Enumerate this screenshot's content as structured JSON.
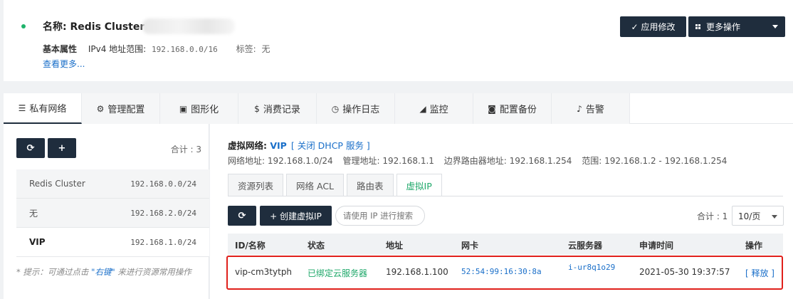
{
  "header": {
    "name_label": "名称: Redis Cluster",
    "attr_title": "基本属性",
    "ipv4_label": "IPv4 地址范围:",
    "ipv4_value": "192.168.0.0/16",
    "tags_label": "标签:",
    "tags_value": "无",
    "more_link": "查看更多...",
    "apply_button": "应用修改",
    "more_actions_button": "更多操作",
    "status_color": "#1fb36b"
  },
  "tabs": [
    {
      "label": "私有网络",
      "icon": "list-icon",
      "glyph": "☰"
    },
    {
      "label": "管理配置",
      "icon": "gears-icon",
      "glyph": "⚙"
    },
    {
      "label": "图形化",
      "icon": "image-icon",
      "glyph": "▣"
    },
    {
      "label": "消费记录",
      "icon": "dollar-icon",
      "glyph": "$"
    },
    {
      "label": "操作日志",
      "icon": "clock-icon",
      "glyph": "◷"
    },
    {
      "label": "监控",
      "icon": "area-chart-icon",
      "glyph": "◢"
    },
    {
      "label": "配置备份",
      "icon": "camera-icon",
      "glyph": "◙"
    },
    {
      "label": "告警",
      "icon": "bell-icon",
      "glyph": "♪"
    }
  ],
  "left": {
    "refresh_glyph": "⟳",
    "add_glyph": "+",
    "total": "合计 : 3",
    "networks": [
      {
        "name": "Redis Cluster",
        "cidr": "192.168.0.0/24",
        "selected": false
      },
      {
        "name": "无",
        "cidr": "192.168.2.0/24",
        "selected": false
      },
      {
        "name": "VIP",
        "cidr": "192.168.1.0/24",
        "selected": true
      }
    ],
    "hint_prefix": "* 提示：可通过点击 ",
    "hint_keyword": "\"右键\"",
    "hint_suffix": " 来进行资源常用操作"
  },
  "vnet": {
    "title_prefix": "虚拟网络: ",
    "title_name": "VIP",
    "dhcp_link": "[ 关闭 DHCP 服务 ]",
    "network_addr": "网络地址: 192.168.1.0/24",
    "mgmt_addr": "管理地址: 192.168.1.1",
    "border_router": "边界路由器地址: 192.168.1.254",
    "range": "范围: 192.168.1.2 - 192.168.1.254"
  },
  "sub_tabs": [
    "资源列表",
    "网络 ACL",
    "路由表",
    "虚拟IP"
  ],
  "toolbar": {
    "refresh_glyph": "⟳",
    "create_label": "+ 创建虚拟IP",
    "search_placeholder": "请使用 IP 进行搜索",
    "total": "合计 : 1",
    "page_size": "10/页"
  },
  "table": {
    "headers": [
      "ID/名称",
      "状态",
      "地址",
      "网卡",
      "云服务器",
      "申请时间",
      "操作"
    ],
    "rows": [
      {
        "id": "vip-cm3tytph",
        "status": "已绑定云服务器",
        "address": "192.168.1.100",
        "nic": "52:54:99:16:30:8a",
        "vm": "i-ur8q1o29",
        "time": "2021-05-30 19:37:57",
        "action": "[ 释放 ]"
      }
    ]
  },
  "colors": {
    "accent_dark": "#1f2d3d",
    "link_blue": "#1a6fc9",
    "success_green": "#1fa86a",
    "highlight_red": "#e0201b"
  }
}
